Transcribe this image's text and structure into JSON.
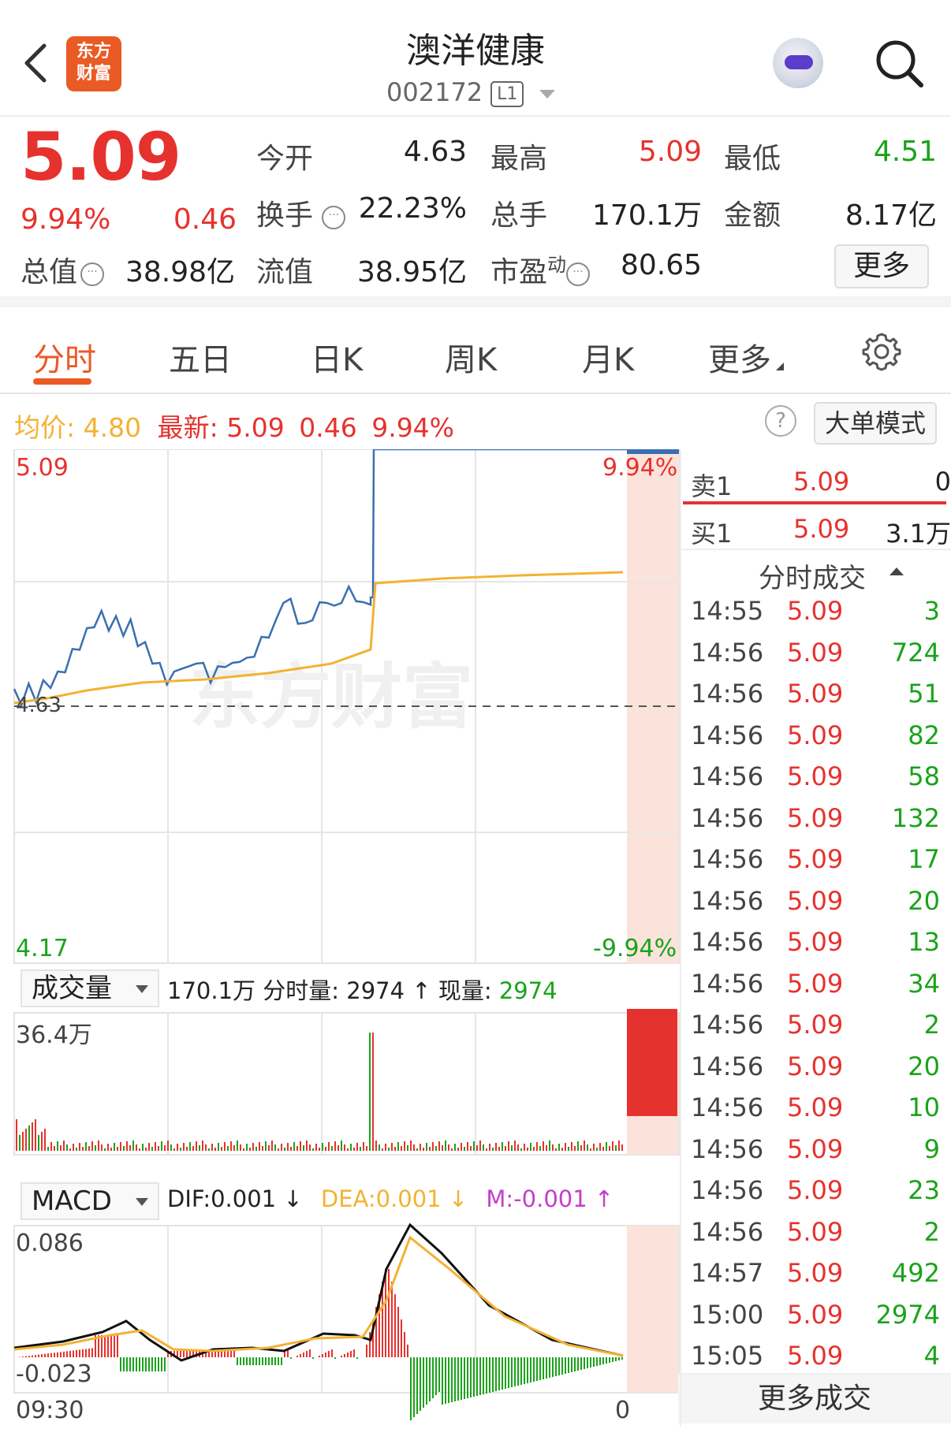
{
  "header": {
    "stock_name": "澳洋健康",
    "stock_code": "002172",
    "level": "L1",
    "logo_line1": "东方",
    "logo_line2": "财富"
  },
  "quote": {
    "price": "5.09",
    "change_pct": "9.94%",
    "change": "0.46",
    "open_label": "今开",
    "open": "4.63",
    "high_label": "最高",
    "high": "5.09",
    "low_label": "最低",
    "low": "4.51",
    "turnover_label": "换手",
    "turnover": "22.23%",
    "volume_label": "总手",
    "volume": "170.1万",
    "amount_label": "金额",
    "amount": "8.17亿",
    "total_mv_label": "总值",
    "total_mv": "38.98亿",
    "float_mv_label": "流值",
    "float_mv": "38.95亿",
    "pe_label": "市盈",
    "pe_sup": "动",
    "pe": "80.65",
    "more_label": "更多"
  },
  "tabs": [
    "分时",
    "五日",
    "日K",
    "周K",
    "月K",
    "更多"
  ],
  "info": {
    "avg_label": "均价:",
    "avg": "4.80",
    "latest_label": "最新:",
    "latest": "5.09",
    "latest_chg": "0.46",
    "latest_pct": "9.94%",
    "help": "?",
    "big_order_label": "大单模式"
  },
  "price_axis": {
    "top": "5.09",
    "top_pct": "9.94%",
    "prev_close": "4.63",
    "bottom": "4.17",
    "bottom_pct": "-9.94%"
  },
  "volume_panel": {
    "selector": "成交量",
    "total": "170.1万",
    "minute_label": "分时量:",
    "minute": "2974",
    "current_label": "现量:",
    "current": "2974",
    "max": "36.4万"
  },
  "macd_panel": {
    "selector": "MACD",
    "dif": "DIF:0.001",
    "dea": "DEA:0.001",
    "m": "M:-0.001",
    "max": "0.086",
    "min": "-0.023"
  },
  "time_axis": {
    "start": "09:30",
    "end": "0"
  },
  "order_book": {
    "sell1_label": "卖1",
    "sell1_price": "5.09",
    "sell1_vol": "0",
    "buy1_label": "买1",
    "buy1_price": "5.09",
    "buy1_vol": "3.1万"
  },
  "trades_title": "分时成交",
  "trades": [
    {
      "time": "14:55",
      "price": "5.09",
      "vol": "3"
    },
    {
      "time": "14:56",
      "price": "5.09",
      "vol": "724"
    },
    {
      "time": "14:56",
      "price": "5.09",
      "vol": "51"
    },
    {
      "time": "14:56",
      "price": "5.09",
      "vol": "82"
    },
    {
      "time": "14:56",
      "price": "5.09",
      "vol": "58"
    },
    {
      "time": "14:56",
      "price": "5.09",
      "vol": "132"
    },
    {
      "time": "14:56",
      "price": "5.09",
      "vol": "17"
    },
    {
      "time": "14:56",
      "price": "5.09",
      "vol": "20"
    },
    {
      "time": "14:56",
      "price": "5.09",
      "vol": "13"
    },
    {
      "time": "14:56",
      "price": "5.09",
      "vol": "34"
    },
    {
      "time": "14:56",
      "price": "5.09",
      "vol": "2"
    },
    {
      "time": "14:56",
      "price": "5.09",
      "vol": "20"
    },
    {
      "time": "14:56",
      "price": "5.09",
      "vol": "10"
    },
    {
      "time": "14:56",
      "price": "5.09",
      "vol": "9"
    },
    {
      "time": "14:56",
      "price": "5.09",
      "vol": "23"
    },
    {
      "time": "14:56",
      "price": "5.09",
      "vol": "2"
    },
    {
      "time": "14:57",
      "price": "5.09",
      "vol": "492"
    },
    {
      "time": "15:00",
      "price": "5.09",
      "vol": "2974"
    },
    {
      "time": "15:05",
      "price": "5.09",
      "vol": "4"
    }
  ],
  "more_trades": "更多成交",
  "colors": {
    "up": "#e6322e",
    "down": "#1aa31a",
    "price_line": "#3a6fb0",
    "avg_line": "#f3b233",
    "accent": "#ea5a24",
    "macd_dif": "#111111",
    "macd_dea": "#f3b233"
  }
}
